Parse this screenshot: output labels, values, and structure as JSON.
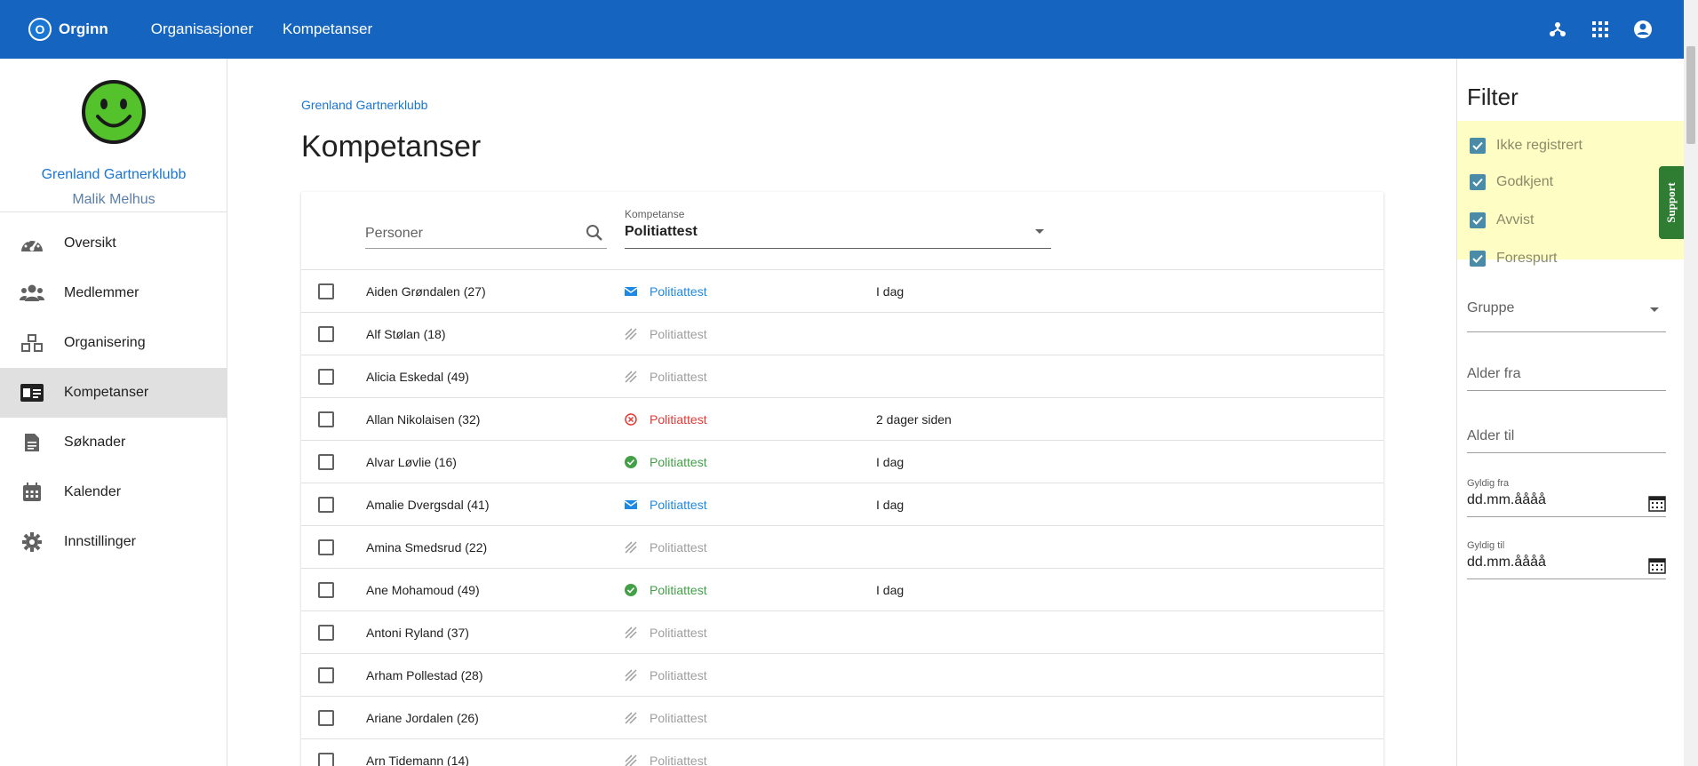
{
  "topbar": {
    "brand_badge": "O",
    "brand": "Orginn",
    "nav": [
      "Organisasjoner",
      "Kompetanser"
    ],
    "icons": [
      "hierarchy-icon",
      "apps-grid-icon",
      "account-circle-icon"
    ]
  },
  "sidebar": {
    "org_name": "Grenland Gartnerklubb",
    "user_name": "Malik Melhus",
    "items": [
      {
        "label": "Oversikt",
        "icon": "speedometer-icon"
      },
      {
        "label": "Medlemmer",
        "icon": "people-icon"
      },
      {
        "label": "Organisering",
        "icon": "cubes-icon"
      },
      {
        "label": "Kompetanser",
        "icon": "id-card-icon",
        "active": true
      },
      {
        "label": "Søknader",
        "icon": "document-icon"
      },
      {
        "label": "Kalender",
        "icon": "calendar-icon"
      },
      {
        "label": "Innstillinger",
        "icon": "gear-icon"
      }
    ]
  },
  "main": {
    "breadcrumb": "Grenland Gartnerklubb",
    "title": "Kompetanser",
    "search_placeholder": "Personer",
    "select_label": "Kompetanse",
    "select_value": "Politiattest",
    "rows": [
      {
        "name": "Aiden Grøndalen (27)",
        "status": "requested",
        "comp": "Politiattest",
        "date": "I dag"
      },
      {
        "name": "Alf Stølan (18)",
        "status": "none",
        "comp": "Politiattest",
        "date": ""
      },
      {
        "name": "Alicia Eskedal (49)",
        "status": "none",
        "comp": "Politiattest",
        "date": ""
      },
      {
        "name": "Allan Nikolaisen (32)",
        "status": "rejected",
        "comp": "Politiattest",
        "date": "2 dager siden"
      },
      {
        "name": "Alvar Løvlie (16)",
        "status": "approved",
        "comp": "Politiattest",
        "date": "I dag"
      },
      {
        "name": "Amalie Dvergsdal (41)",
        "status": "requested",
        "comp": "Politiattest",
        "date": "I dag"
      },
      {
        "name": "Amina Smedsrud (22)",
        "status": "none",
        "comp": "Politiattest",
        "date": ""
      },
      {
        "name": "Ane Mohamoud (49)",
        "status": "approved",
        "comp": "Politiattest",
        "date": "I dag"
      },
      {
        "name": "Antoni Ryland (37)",
        "status": "none",
        "comp": "Politiattest",
        "date": ""
      },
      {
        "name": "Arham Pollestad (28)",
        "status": "none",
        "comp": "Politiattest",
        "date": ""
      },
      {
        "name": "Ariane Jordalen (26)",
        "status": "none",
        "comp": "Politiattest",
        "date": ""
      },
      {
        "name": "Arn Tidemann (14)",
        "status": "none",
        "comp": "Politiattest",
        "date": ""
      }
    ],
    "status_colors": {
      "requested": "#1e88e5",
      "none": "#9e9e9e",
      "rejected": "#e53935",
      "approved": "#43a047"
    }
  },
  "filter": {
    "title": "Filter",
    "checks": [
      "Ikke registrert",
      "Godkjent",
      "Avvist",
      "Forespurt"
    ],
    "support": "Support",
    "group_label": "Gruppe",
    "age_from": "Alder fra",
    "age_to": "Alder til",
    "valid_from_label": "Gyldig fra",
    "valid_from_value": "dd.mm.åååå",
    "valid_to_label": "Gyldig til",
    "valid_to_value": "dd.mm.åååå"
  }
}
